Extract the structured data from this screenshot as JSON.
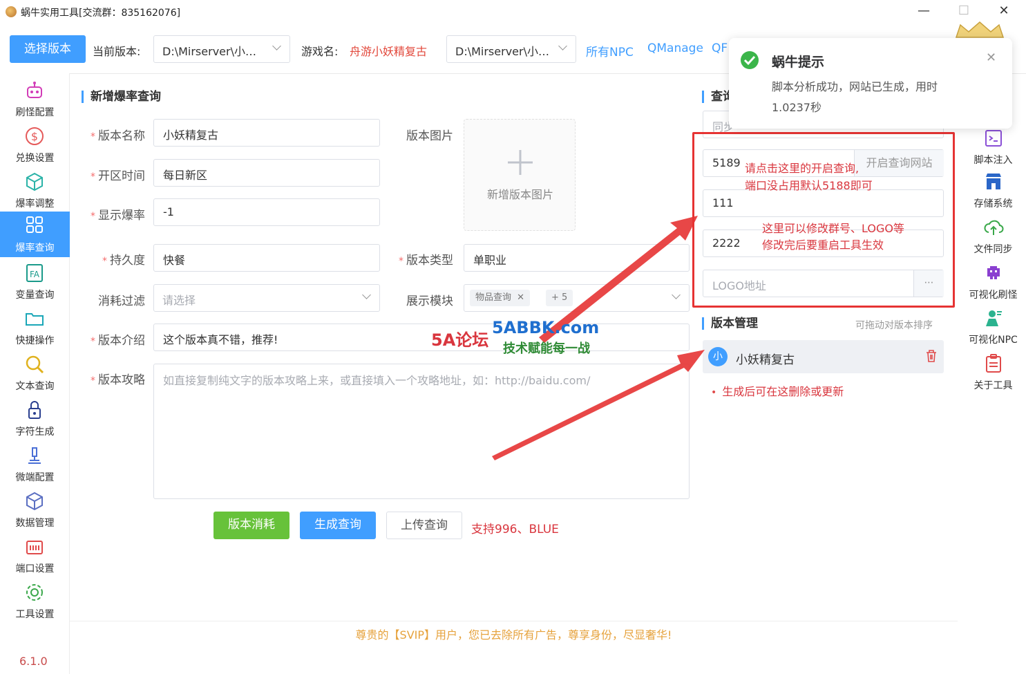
{
  "window": {
    "title": "蜗牛实用工具[交流群：835162076]",
    "minimize": "—",
    "maximize": "☐",
    "close": "✕"
  },
  "toolbar": {
    "select_version_btn": "选择版本",
    "current_version_label": "当前版本:",
    "current_version_value": "D:\\Mirserver\\小…",
    "game_name_label": "游戏名:",
    "game_name_value": "舟游小妖精复古",
    "path_select_value": "D:\\Mirserver\\小…",
    "links": [
      "所有NPC",
      "QManage",
      "QF"
    ]
  },
  "sidebar": {
    "items": [
      {
        "label": "刷怪配置",
        "icon": "robot-icon"
      },
      {
        "label": "兑换设置",
        "icon": "dollar-icon"
      },
      {
        "label": "爆率调整",
        "icon": "box-icon"
      },
      {
        "label": "爆率查询",
        "icon": "grid-search-icon",
        "active": true
      },
      {
        "label": "变量查询",
        "icon": "variable-icon"
      },
      {
        "label": "快捷操作",
        "icon": "folder-icon"
      },
      {
        "label": "文本查询",
        "icon": "search-icon"
      },
      {
        "label": "字符生成",
        "icon": "lock-icon"
      },
      {
        "label": "微端配置",
        "icon": "microscope-icon"
      },
      {
        "label": "数据管理",
        "icon": "cube-icon"
      },
      {
        "label": "端口设置",
        "icon": "port-icon"
      },
      {
        "label": "工具设置",
        "icon": "gear-icon"
      }
    ],
    "version": "6.1.0"
  },
  "form": {
    "section_title": "新增爆率查询",
    "version_name_label": "版本名称",
    "version_name_value": "小妖精复古",
    "open_time_label": "开区时间",
    "open_time_value": "每日新区",
    "show_rate_label": "显示爆率",
    "show_rate_value": "-1",
    "durability_label": "持久度",
    "durability_value": "快餐",
    "consume_filter_label": "消耗过滤",
    "consume_filter_placeholder": "请选择",
    "version_intro_label": "版本介绍",
    "version_intro_value": "这个版本真不错，推荐!",
    "version_guide_label": "版本攻略",
    "version_guide_placeholder": "如直接复制纯文字的版本攻略上来，或直接填入一个攻略地址，如：http://baidu.com/",
    "version_image_label": "版本图片",
    "add_image_text": "新增版本图片",
    "version_type_label": "版本类型",
    "version_type_value": "单职业",
    "display_module_label": "展示模块",
    "display_module_tag": "物品查询",
    "display_module_more": "+ 5",
    "btn_consume": "版本消耗",
    "btn_generate": "生成查询",
    "btn_upload": "上传查询",
    "support_text": "支持996、BLUE"
  },
  "query_panel": {
    "section_title": "查询",
    "first_input": "同步",
    "port_value": "5189",
    "open_site_btn": "开启查询网站",
    "field2_value": "111",
    "field3_value": "2222",
    "logo_placeholder": "LOGO地址",
    "annotation1_line1": "请点击这里的开启查询,",
    "annotation1_line2": "端口没占用默认5188即可",
    "annotation2_line1": "这里可以修改群号、LOGO等",
    "annotation2_line2": "修改完后要重启工具生效"
  },
  "version_manage": {
    "section_title": "版本管理",
    "hint": "可拖动对版本排序",
    "item_avatar": "小",
    "item_name": "小妖精复古",
    "note": "生成后可在这删除或更新"
  },
  "right_sidebar": {
    "items": [
      {
        "label": "脚本注入",
        "icon": "terminal-icon"
      },
      {
        "label": "存储系统",
        "icon": "store-icon"
      },
      {
        "label": "文件同步",
        "icon": "cloud-sync-icon"
      },
      {
        "label": "可视化刷怪",
        "icon": "invader-icon"
      },
      {
        "label": "可视化NPC",
        "icon": "npc-icon"
      },
      {
        "label": "关于工具",
        "icon": "clipboard-icon"
      }
    ]
  },
  "notification": {
    "title": "蜗牛提示",
    "message_line1": "脚本分析成功，网站已生成，用时",
    "message_line2": "1.0237秒"
  },
  "watermark": {
    "line1": "5A论坛",
    "line2": "5ABBK.com",
    "line3": "技术赋能每一战"
  },
  "footer": {
    "text": "尊贵的【SVIP】用户，您已去除所有广告，尊享身份，尽显奢华!"
  }
}
